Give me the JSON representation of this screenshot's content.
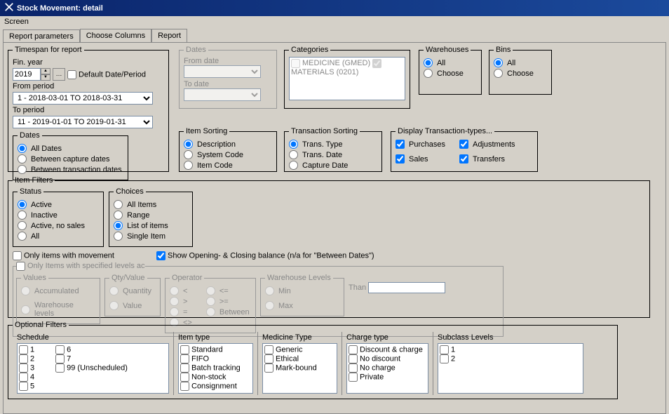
{
  "title": "Stock Movement: detail",
  "menubar": {
    "screen": "Screen"
  },
  "tabs": {
    "params": "Report parameters",
    "cols": "Choose Columns",
    "report": "Report"
  },
  "timespan": {
    "legend": "Timespan for report",
    "finYearLabel": "Fin. year",
    "finYear": "2019",
    "defaultDate": "Default Date/Period",
    "fromPeriodLabel": "From period",
    "fromPeriod": "1  - 2018-03-01 TO 2018-03-31",
    "toPeriodLabel": "To period",
    "toPeriod": "11 - 2019-01-01 TO 2019-01-31",
    "datesLegend": "Dates",
    "allDates": "All Dates",
    "betweenCapture": "Between capture dates",
    "betweenTrans": "Between transaction dates"
  },
  "datesGroup": {
    "legend": "Dates",
    "fromLabel": "From date",
    "toLabel": "To date"
  },
  "categories": {
    "legend": "Categories",
    "items": [
      {
        "label": "MEDICINE  (GMED)",
        "checked": false
      },
      {
        "label": "MATERIALS  (0201)",
        "checked": true
      }
    ]
  },
  "warehouses": {
    "legend": "Warehouses",
    "all": "All",
    "choose": "Choose"
  },
  "bins": {
    "legend": "Bins",
    "all": "All",
    "choose": "Choose"
  },
  "itemSort": {
    "legend": "Item Sorting",
    "desc": "Description",
    "sys": "System Code",
    "item": "Item Code"
  },
  "transSort": {
    "legend": "Transaction Sorting",
    "type": "Trans. Type",
    "date": "Trans. Date",
    "capture": "Capture Date"
  },
  "display": {
    "legend": "Display Transaction-types...",
    "purchases": "Purchases",
    "adjustments": "Adjustments",
    "sales": "Sales",
    "transfers": "Transfers"
  },
  "itemFilters": {
    "legend": "Item Filters",
    "statusLegend": "Status",
    "active": "Active",
    "inactive": "Inactive",
    "activeNoSales": "Active, no sales",
    "all": "All",
    "choicesLegend": "Choices",
    "allItems": "All Items",
    "range": "Range",
    "listOfItems": "List of items",
    "single": "Single Item",
    "onlyMovement": "Only items with movement",
    "showOpening": "Show Opening- & Closing balance (n/a for \"Between Dates\")",
    "onlyLevels": "Only Items with specified levels ac",
    "valuesLegend": "Values",
    "accum": "Accumulated",
    "wh": "Warehouse levels",
    "qtyLegend": "Qty/Value",
    "qty": "Quantity",
    "val": "Value",
    "opLegend": "Operator",
    "lt": "<",
    "gt": ">",
    "eq": "=",
    "ne": "<>",
    "le": "<=",
    "ge": ">=",
    "between": "Between",
    "whLegend": "Warehouse Levels",
    "min": "Min",
    "max": "Max",
    "thanLabel": "Than"
  },
  "optional": {
    "legend": "Optional Filters",
    "schedule": {
      "h": "Schedule",
      "col1": [
        "1",
        "2",
        "3",
        "4",
        "5"
      ],
      "col2": [
        "6",
        "7",
        "99 (Unscheduled)"
      ]
    },
    "itemType": {
      "h": "Item type",
      "items": [
        "Standard",
        "FIFO",
        "Batch tracking",
        "Non-stock",
        "Consignment"
      ]
    },
    "medType": {
      "h": "Medicine Type",
      "items": [
        "Generic",
        "Ethical",
        "Mark-bound"
      ]
    },
    "chargeType": {
      "h": "Charge type",
      "items": [
        "Discount & charge",
        "No discount",
        "No charge",
        "Private"
      ]
    },
    "subclass": {
      "h": "Subclass Levels",
      "items": [
        "1",
        "2"
      ]
    }
  }
}
